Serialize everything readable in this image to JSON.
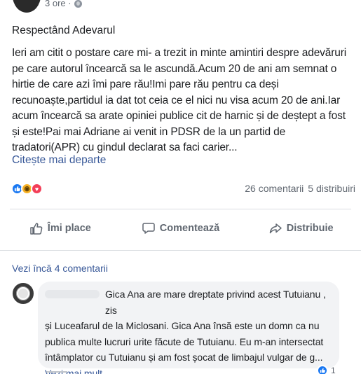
{
  "post": {
    "time": "3 ore ·",
    "title": "Respectând Adevarul",
    "body": "Ieri am citit o postare care mi- a trezit in minte amintiri despre adevăruri pe care autorul încearcă sa le ascundă.Acum 20 de ani am semnat o hirtie de care azi îmi pare rău!Imi pare rău pentru ca deși recunoaște,partidul ia dat tot ceia ce el nici nu visa acum 20 de ani.Iar acum încearcă sa arate opiniei publice cit de harnic și de deștept a fost și este!Pai mai Adriane ai venit in PDSR de la un partid de tradatori(APR) cu gindul declarat sa faci carier...",
    "see_more": "Citește mai departe",
    "comments_count": "26 comentarii",
    "shares_count": "5 distribuiri",
    "reaction_icons": [
      "like-icon",
      "wow-icon",
      "love-icon"
    ]
  },
  "actions": {
    "like": "Îmi place",
    "comment": "Comentează",
    "share": "Distribuie"
  },
  "comments": {
    "more_label": "Vezi încă 4 comentarii",
    "first": {
      "line1": "Gica Ana are mare dreptate privind acest Tutuianu , zis",
      "rest": "și Luceafarul de la Miclosani. Gica Ana însă este un domn ca nu publica multe lucruri urite făcute de Tutuianu. Eu m-an intersectat întâmplator cu Tutuianu și am fost șocat de limbajul vulgar de g...",
      "see_more": "Vezi mai mult",
      "reaction_count": "1"
    }
  },
  "colors": {
    "link": "#385898",
    "muted": "#606770",
    "like_blue": "#1877f2",
    "bubble": "#f2f3f5"
  }
}
